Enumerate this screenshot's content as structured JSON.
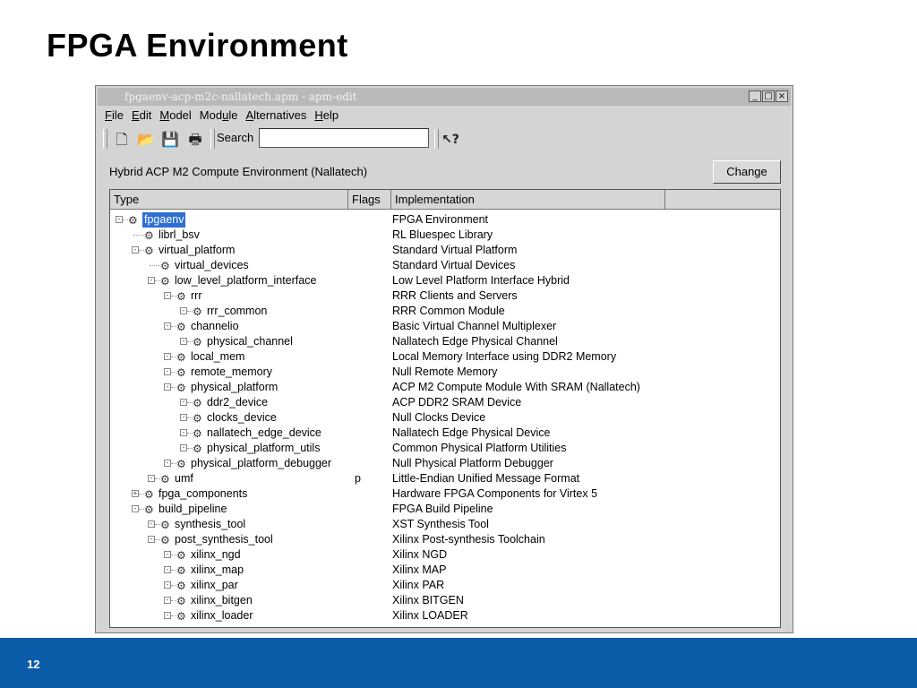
{
  "slide": {
    "title": "FPGA Environment",
    "page_number": "12"
  },
  "window": {
    "title": "fpgaenv-acp-m2c-nallatech.apm - apm-edit",
    "controls": {
      "minimize": "_",
      "maximize": "□",
      "close": "×"
    }
  },
  "menu": [
    {
      "ul": "F",
      "rest": "ile"
    },
    {
      "ul": "E",
      "rest": "dit"
    },
    {
      "ul": "M",
      "rest": "odel"
    },
    {
      "pre": "Mod",
      "ul": "u",
      "rest": "le"
    },
    {
      "ul": "A",
      "rest": "lternatives"
    },
    {
      "ul": "H",
      "rest": "elp"
    }
  ],
  "toolbar": {
    "search_label": "Search",
    "search_value": ""
  },
  "environment": {
    "label": "Hybrid ACP M2 Compute Environment (Nallatech)",
    "change_button": "Change"
  },
  "columns": {
    "type": "Type",
    "flags": "Flags",
    "implementation": "Implementation"
  },
  "rows": [
    {
      "name": "fpgaenv",
      "level": 0,
      "expander": "-",
      "flags": "",
      "impl": "FPGA Environment",
      "selected": true
    },
    {
      "name": "librl_bsv",
      "level": 1,
      "expander": "",
      "flags": "",
      "impl": "RL Bluespec Library"
    },
    {
      "name": "virtual_platform",
      "level": 1,
      "expander": "-",
      "flags": "",
      "impl": "Standard Virtual Platform"
    },
    {
      "name": "virtual_devices",
      "level": 2,
      "expander": "",
      "flags": "",
      "impl": "Standard Virtual Devices"
    },
    {
      "name": "low_level_platform_interface",
      "level": 2,
      "expander": "-",
      "flags": "",
      "impl": "Low Level Platform Interface Hybrid"
    },
    {
      "name": "rrr",
      "level": 3,
      "expander": "-",
      "flags": "",
      "impl": "RRR Clients and Servers"
    },
    {
      "name": "rrr_common",
      "level": 4,
      "expander": "-",
      "flags": "",
      "impl": "RRR Common Module"
    },
    {
      "name": "channelio",
      "level": 3,
      "expander": "-",
      "flags": "",
      "impl": "Basic Virtual Channel Multiplexer"
    },
    {
      "name": "physical_channel",
      "level": 4,
      "expander": "-",
      "flags": "",
      "impl": "Nallatech Edge Physical Channel"
    },
    {
      "name": "local_mem",
      "level": 3,
      "expander": "-",
      "flags": "",
      "impl": "Local Memory Interface using DDR2 Memory"
    },
    {
      "name": "remote_memory",
      "level": 3,
      "expander": "-",
      "flags": "",
      "impl": "Null Remote Memory"
    },
    {
      "name": "physical_platform",
      "level": 3,
      "expander": "-",
      "flags": "",
      "impl": "ACP M2 Compute Module With SRAM (Nallatech)"
    },
    {
      "name": "ddr2_device",
      "level": 4,
      "expander": "-",
      "flags": "",
      "impl": "ACP DDR2 SRAM Device"
    },
    {
      "name": "clocks_device",
      "level": 4,
      "expander": "-",
      "flags": "",
      "impl": "Null Clocks Device"
    },
    {
      "name": "nallatech_edge_device",
      "level": 4,
      "expander": "-",
      "flags": "",
      "impl": "Nallatech Edge Physical Device"
    },
    {
      "name": "physical_platform_utils",
      "level": 4,
      "expander": "-",
      "flags": "",
      "impl": "Common Physical Platform Utilities"
    },
    {
      "name": "physical_platform_debugger",
      "level": 3,
      "expander": "-",
      "flags": "",
      "impl": "Null Physical Platform Debugger"
    },
    {
      "name": "umf",
      "level": 2,
      "expander": "-",
      "flags": "p",
      "impl": "Little-Endian Unified Message Format"
    },
    {
      "name": "fpga_components",
      "level": 1,
      "expander": "+",
      "flags": "",
      "impl": "Hardware FPGA Components for Virtex 5"
    },
    {
      "name": "build_pipeline",
      "level": 1,
      "expander": "-",
      "flags": "",
      "impl": "FPGA Build Pipeline"
    },
    {
      "name": "synthesis_tool",
      "level": 2,
      "expander": "-",
      "flags": "",
      "impl": "XST Synthesis Tool"
    },
    {
      "name": "post_synthesis_tool",
      "level": 2,
      "expander": "-",
      "flags": "",
      "impl": "Xilinx Post-synthesis Toolchain"
    },
    {
      "name": "xilinx_ngd",
      "level": 3,
      "expander": "-",
      "flags": "",
      "impl": "Xilinx NGD"
    },
    {
      "name": "xilinx_map",
      "level": 3,
      "expander": "-",
      "flags": "",
      "impl": "Xilinx MAP"
    },
    {
      "name": "xilinx_par",
      "level": 3,
      "expander": "-",
      "flags": "",
      "impl": "Xilinx PAR"
    },
    {
      "name": "xilinx_bitgen",
      "level": 3,
      "expander": "-",
      "flags": "",
      "impl": "Xilinx BITGEN"
    },
    {
      "name": "xilinx_loader",
      "level": 3,
      "expander": "-",
      "flags": "",
      "impl": "Xilinx LOADER"
    }
  ]
}
